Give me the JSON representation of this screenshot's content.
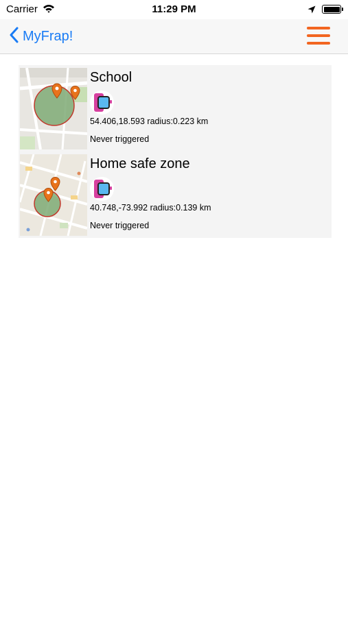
{
  "status_bar": {
    "carrier": "Carrier",
    "time": "11:29 PM"
  },
  "nav": {
    "back_label": "MyFrap!",
    "accent_color": "#f26520",
    "link_color": "#1a7cf5"
  },
  "zones": [
    {
      "title": "School",
      "coordinates": "54.406,18.593 radius:0.223 km",
      "trigger_status": "Never triggered"
    },
    {
      "title": "Home safe zone",
      "coordinates": "40.748,-73.992 radius:0.139 km",
      "trigger_status": "Never triggered"
    }
  ]
}
